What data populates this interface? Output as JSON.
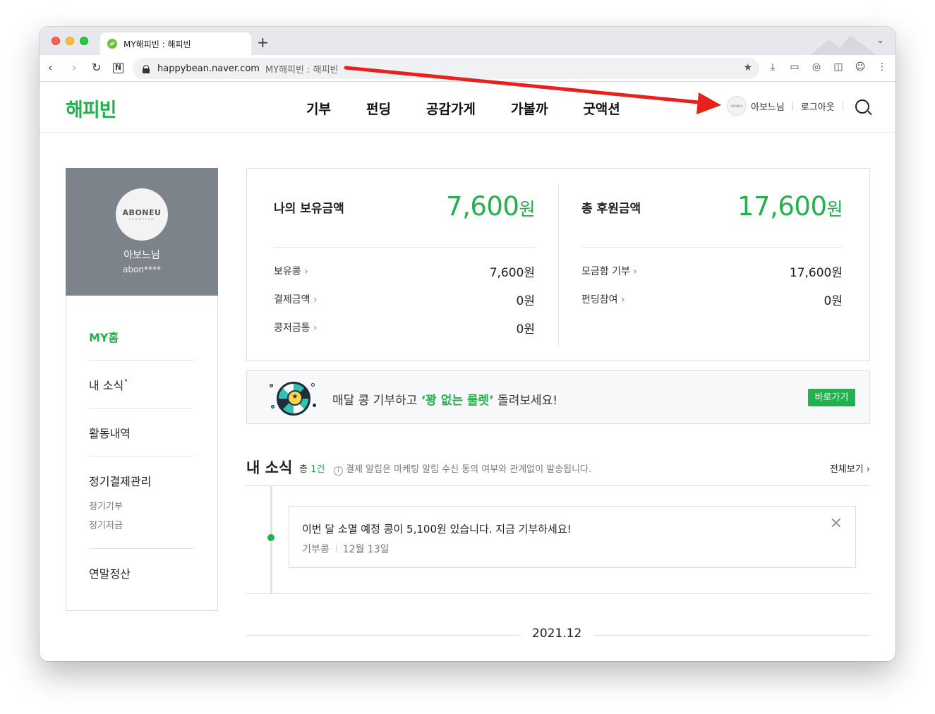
{
  "browser": {
    "tab_title": "MY해피빈 : 해피빈",
    "new_tab": "+",
    "url_host": "happybean.naver.com",
    "url_title": "MY해피빈 : 해피빈",
    "nav_back": "‹",
    "nav_forward": "›",
    "nav_reload": "↻",
    "nav_home": "N"
  },
  "site": {
    "logo": "해피빈",
    "menu": [
      "기부",
      "펀딩",
      "공감가게",
      "가볼까",
      "굿액션"
    ],
    "user_name": "아보느님",
    "logout": "로그아웃",
    "avatar_text": "ABONEU"
  },
  "profile": {
    "brand": "ABONEU",
    "brand_sub": "creative",
    "name": "아보느님",
    "id": "abon****"
  },
  "lnb": {
    "home": "MY홈",
    "news": "내 소식",
    "news_dot": "•",
    "activity": "활동내역",
    "billing": "정기결제관리",
    "billing_sub1": "정기기부",
    "billing_sub2": "정기저금",
    "tax": "연말정산"
  },
  "summary": {
    "left": {
      "title": "나의 보유금액",
      "amount": "7,600",
      "unit": "원",
      "rows": [
        {
          "label": "보유콩",
          "value": "7,600원"
        },
        {
          "label": "결제금액",
          "value": "0원"
        },
        {
          "label": "콩저금통",
          "value": "0원"
        }
      ]
    },
    "right": {
      "title": "총 후원금액",
      "amount": "17,600",
      "unit": "원",
      "rows": [
        {
          "label": "모금함 기부",
          "value": "17,600원"
        },
        {
          "label": "펀딩참여",
          "value": "0원"
        }
      ]
    }
  },
  "banner": {
    "text_before": "매달 콩 기부하고 ",
    "text_highlight": "‘꽝 없는 룰렛’",
    "text_after": " 돌려보세요!",
    "button": "바로가기"
  },
  "news": {
    "title": "내 소식",
    "count_prefix": "총 ",
    "count": "1건",
    "info_icon": "i",
    "notice": "결제 알림은 마케팅 알림 수신 동의 여부와 관계없이 발송됩니다.",
    "view_all": "전체보기 ›",
    "item": {
      "message": "이번 달 소멸 예정 콩이 5,100원 있습니다. 지금 기부하세요!",
      "category": "기부콩",
      "date": "12월 13일",
      "close": "✕"
    },
    "month": "2021.12"
  },
  "colors": {
    "brand_green": "#21b14d",
    "annotation_arrow": "#e8221b"
  }
}
